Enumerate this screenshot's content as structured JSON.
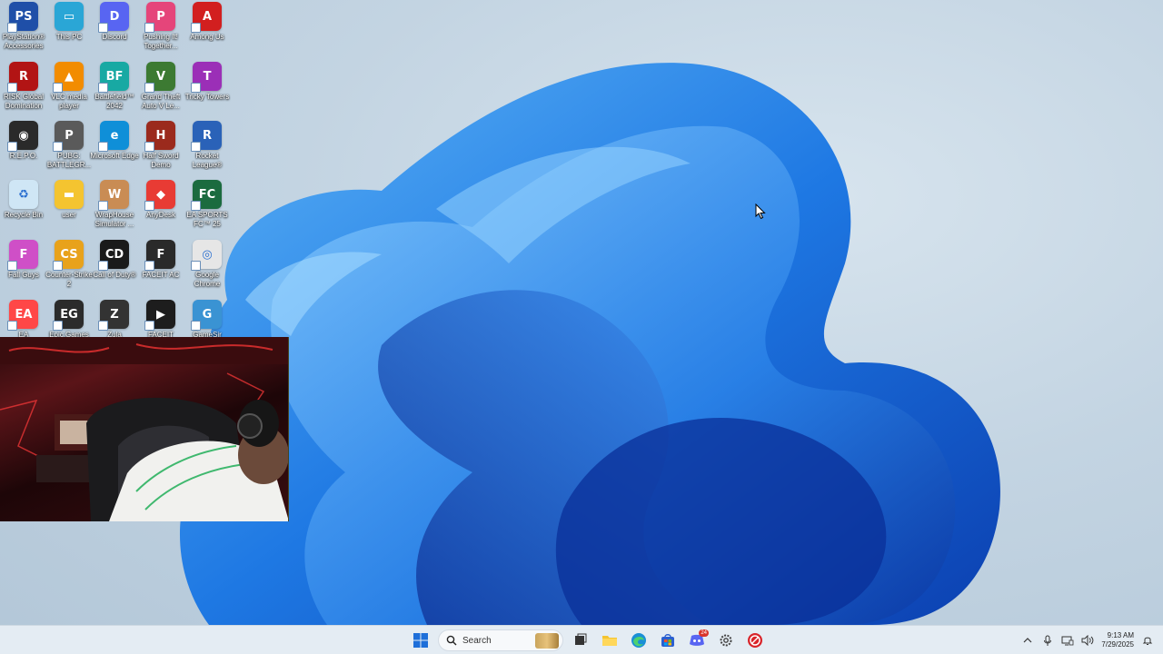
{
  "desktop": {
    "icons": [
      {
        "label": "PlayStation® Accessories",
        "color": "#1f4fa8",
        "glyph": "PS"
      },
      {
        "label": "This PC",
        "color": "#2aa6d6",
        "glyph": "▭"
      },
      {
        "label": "Discord",
        "color": "#5865f2",
        "glyph": "D"
      },
      {
        "label": "Pushing It! Together...",
        "color": "#e5457a",
        "glyph": "P"
      },
      {
        "label": "Among Us",
        "color": "#d21f1f",
        "glyph": "A"
      },
      {
        "label": "RISK Global Domination",
        "color": "#b21414",
        "glyph": "R"
      },
      {
        "label": "VLC media player",
        "color": "#f28c00",
        "glyph": "▲"
      },
      {
        "label": "Battlefield™ 2042",
        "color": "#18a9a3",
        "glyph": "BF"
      },
      {
        "label": "Grand Theft Auto V Le...",
        "color": "#3c7a32",
        "glyph": "V"
      },
      {
        "label": "Tricky Towers",
        "color": "#9b2fb7",
        "glyph": "T"
      },
      {
        "label": "R.E.P.O.",
        "color": "#2a2a2a",
        "glyph": "◉"
      },
      {
        "label": "PUBG: BATTLEGR...",
        "color": "#5a5a5a",
        "glyph": "P"
      },
      {
        "label": "Microsoft Edge",
        "color": "#0f8fd8",
        "glyph": "e"
      },
      {
        "label": "Half Sword Demo",
        "color": "#9b2a1d",
        "glyph": "H"
      },
      {
        "label": "Rocket League®",
        "color": "#2a62b8",
        "glyph": "R"
      },
      {
        "label": "Recycle Bin",
        "color": "#cfe6f5",
        "glyph": "♻"
      },
      {
        "label": "user",
        "color": "#f4c430",
        "glyph": "▬"
      },
      {
        "label": "WrapHouse Simulator ...",
        "color": "#c98c54",
        "glyph": "W"
      },
      {
        "label": "AnyDesk",
        "color": "#e83b34",
        "glyph": "◆"
      },
      {
        "label": "EA SPORTS FC™ 25",
        "color": "#1b6b3f",
        "glyph": "FC"
      },
      {
        "label": "Fall Guys",
        "color": "#cf4fc7",
        "glyph": "F"
      },
      {
        "label": "Counter-Strike 2",
        "color": "#e8a21b",
        "glyph": "CS"
      },
      {
        "label": "Call of Duty®",
        "color": "#1a1a1a",
        "glyph": "CD"
      },
      {
        "label": "FACEIT AC",
        "color": "#2a2a2a",
        "glyph": "F"
      },
      {
        "label": "Google Chrome",
        "color": "#e6e6e6",
        "glyph": "◎"
      },
      {
        "label": "EA",
        "color": "#ff4747",
        "glyph": "EA"
      },
      {
        "label": "Epic Games",
        "color": "#2b2b2b",
        "glyph": "EG"
      },
      {
        "label": "Zula",
        "color": "#333333",
        "glyph": "Z"
      },
      {
        "label": "FACEIT",
        "color": "#1d1d1d",
        "glyph": "▶"
      },
      {
        "label": "GameSir",
        "color": "#3a93d3",
        "glyph": "G"
      }
    ]
  },
  "taskbar": {
    "search_placeholder": "Search",
    "apps": [
      "start-icon",
      "search-icon",
      "task-view-icon",
      "file-explorer-icon",
      "edge-icon",
      "store-icon",
      "discord-icon",
      "settings-icon",
      "game-app-icon"
    ],
    "discord_badge": "24",
    "time": "9:13 AM",
    "date": "7/29/2025"
  },
  "colors": {
    "accent": "#1e6fd9",
    "taskbar_bg": "#e4ecf3"
  }
}
